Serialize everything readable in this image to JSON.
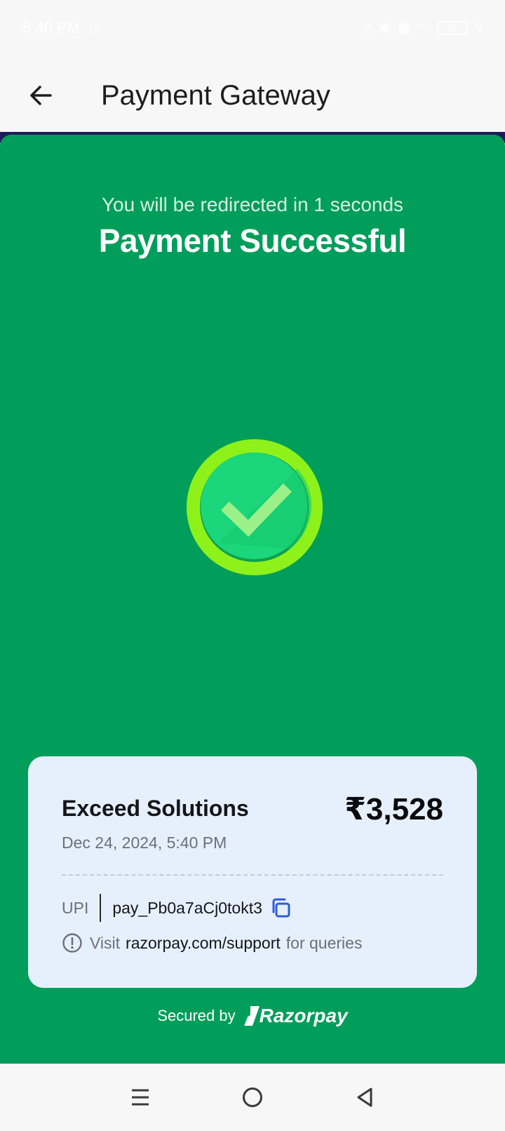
{
  "status_bar": {
    "time": "5:40 PM",
    "battery": "55"
  },
  "header": {
    "title": "Payment Gateway"
  },
  "main": {
    "redirect_text": "You will be redirected in 1 seconds",
    "title": "Payment Successful"
  },
  "receipt": {
    "merchant": "Exceed Solutions",
    "amount": "₹3,528",
    "datetime": "Dec 24, 2024, 5:40 PM",
    "method": "UPI",
    "payment_id": "pay_Pb0a7aCj0tokt3",
    "support_prefix": "Visit",
    "support_link": "razorpay.com/support",
    "support_suffix": "for queries"
  },
  "footer": {
    "secured_by": "Secured by",
    "brand": "Razorpay"
  },
  "colors": {
    "background": "#009e5a",
    "card": "#e6f0fd",
    "check_ring": "#8ef21a",
    "check_fill": "#1bd67a",
    "copy_icon": "#2f5bd6"
  }
}
